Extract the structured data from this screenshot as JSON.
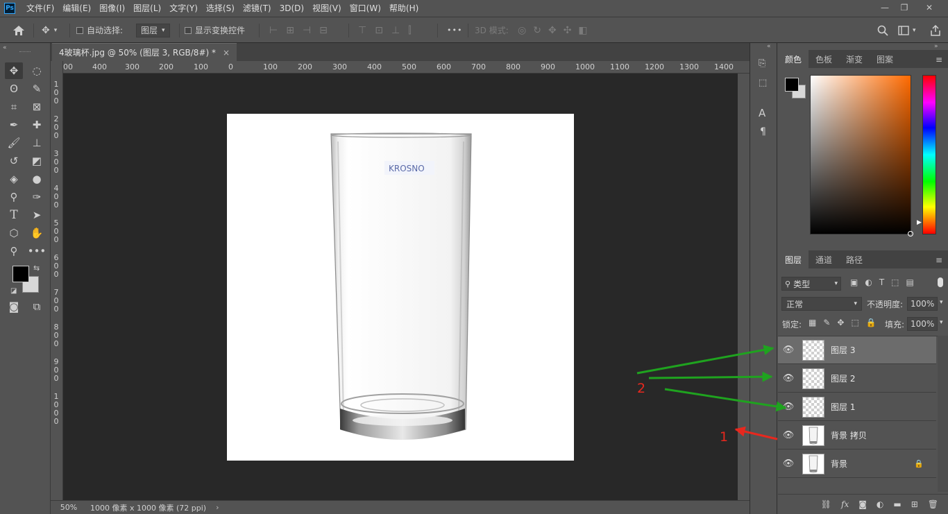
{
  "app": {
    "logo": "Ps"
  },
  "menu": [
    "文件(F)",
    "编辑(E)",
    "图像(I)",
    "图层(L)",
    "文字(Y)",
    "选择(S)",
    "滤镜(T)",
    "3D(D)",
    "视图(V)",
    "窗口(W)",
    "帮助(H)"
  ],
  "window_controls": {
    "minimize": "—",
    "restore": "❐",
    "close": "✕"
  },
  "options": {
    "auto_select_label": "自动选择:",
    "auto_select_target": "图层",
    "show_transform_label": "显示变换控件",
    "mode_3d_label": "3D 模式:",
    "more": "•••"
  },
  "document": {
    "tab_title": "4玻璃杯.jpg @ 50% (图层 3, RGB/8#) *",
    "close_glyph": "×",
    "zoom": "50%",
    "info": "1000 像素 x 1000 像素 (72 ppi)",
    "status_arrow": "›",
    "logo_text": "KROSNO"
  },
  "ruler": {
    "h": [
      "00",
      "400",
      "300",
      "200",
      "100",
      "0",
      "100",
      "200",
      "300",
      "400",
      "500",
      "600",
      "700",
      "800",
      "900",
      "1000",
      "1100",
      "1200",
      "1300",
      "1400"
    ],
    "v": [
      "1\n0\n0",
      "2\n0\n0",
      "3\n0\n0",
      "4\n0\n0",
      "5\n0\n0",
      "6\n0\n0",
      "7\n0\n0",
      "8\n0\n0",
      "9\n0\n0",
      "1\n0\n0\n0"
    ]
  },
  "color_panel": {
    "tabs": [
      "颜色",
      "色板",
      "渐变",
      "图案"
    ],
    "active_tab": "颜色",
    "foreground": "#000000",
    "background": "#d8d8d8",
    "hue_color": "#ff6a00"
  },
  "layers_panel": {
    "tabs": [
      "图层",
      "通道",
      "路径"
    ],
    "active_tab": "图层",
    "filter_label": "类型",
    "blend_mode": "正常",
    "opacity_label": "不透明度:",
    "opacity_value": "100%",
    "lock_label": "锁定:",
    "fill_label": "填充:",
    "fill_value": "100%",
    "layers": [
      {
        "name": "图层 3",
        "type": "transparent",
        "selected": true,
        "locked": false
      },
      {
        "name": "图层 2",
        "type": "transparent",
        "selected": false,
        "locked": false
      },
      {
        "name": "图层 1",
        "type": "transparent",
        "selected": false,
        "locked": false
      },
      {
        "name": "背景 拷贝",
        "type": "image",
        "selected": false,
        "locked": false
      },
      {
        "name": "背景",
        "type": "image",
        "selected": false,
        "locked": true
      }
    ],
    "footer_fx": "fx"
  },
  "annotations": {
    "label_1": "1",
    "label_2": "2",
    "red": "#e8281e",
    "green": "#1fa31f"
  }
}
